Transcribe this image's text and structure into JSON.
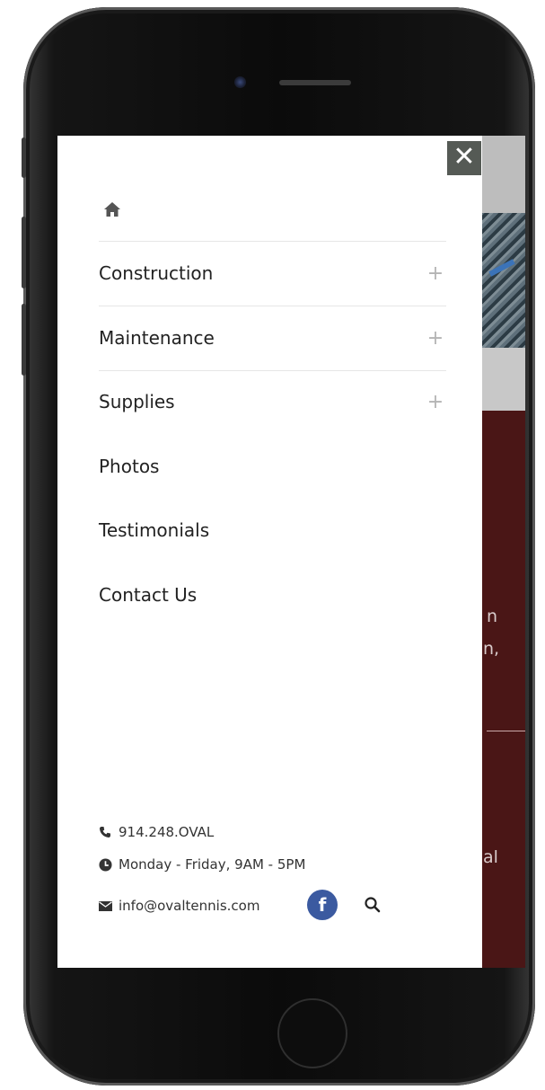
{
  "menu": {
    "close_label": "✕",
    "home_icon": "home-icon",
    "items": [
      {
        "label": "Construction",
        "expandable": true,
        "plus": "+"
      },
      {
        "label": "Maintenance",
        "expandable": true,
        "plus": "+"
      },
      {
        "label": "Supplies",
        "expandable": true,
        "plus": "+"
      },
      {
        "label": "Photos",
        "expandable": false
      },
      {
        "label": "Testimonials",
        "expandable": false
      },
      {
        "label": "Contact Us",
        "expandable": false
      }
    ]
  },
  "contact": {
    "phone": "914.248.OVAL",
    "hours": "Monday - Friday, 9AM - 5PM",
    "email": "info@ovaltennis.com",
    "facebook_label": "f"
  },
  "background": {
    "text_1": "n",
    "text_2": "n,",
    "text_3": "al"
  },
  "colors": {
    "close_bg": "#555a55",
    "facebook_blue": "#3b5aa0",
    "brand_red": "#4a1616"
  }
}
